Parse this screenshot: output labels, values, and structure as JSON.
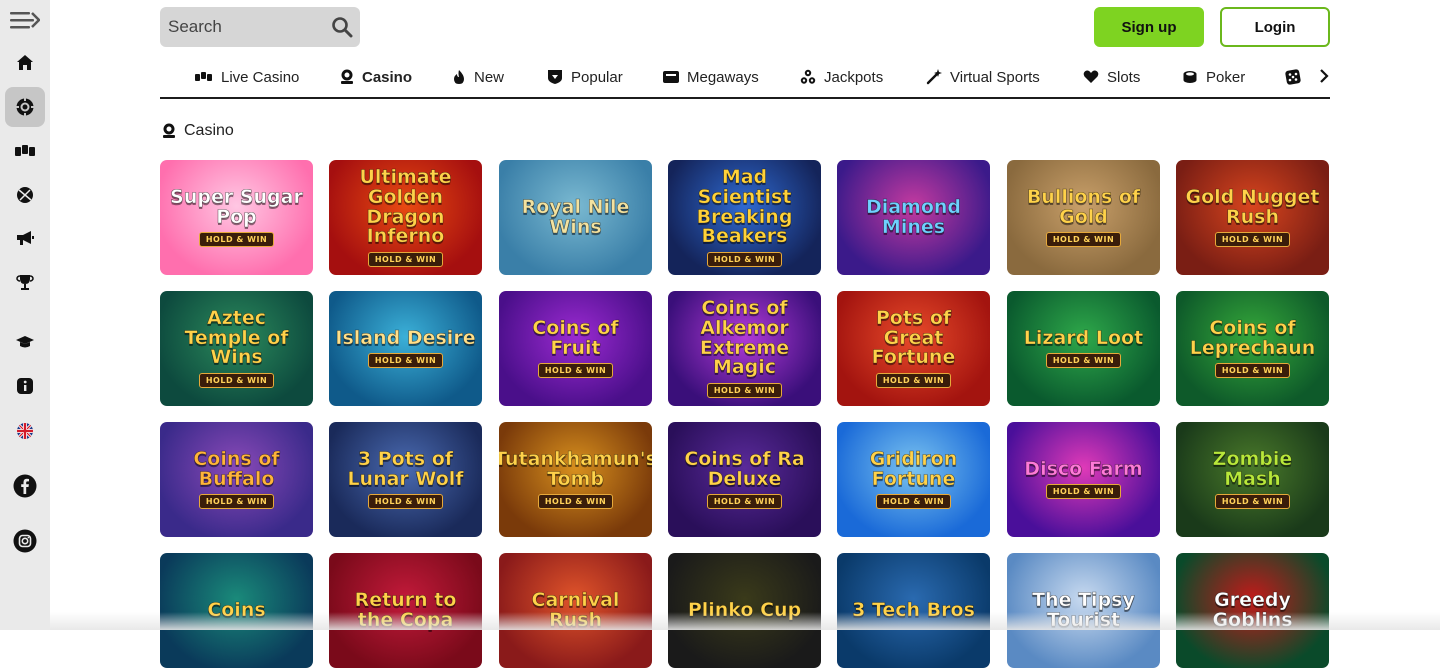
{
  "search": {
    "placeholder": "Search"
  },
  "auth": {
    "signup_label": "Sign up",
    "login_label": "Login"
  },
  "sidebar": {
    "items": [
      {
        "icon": "menu-collapse-icon"
      },
      {
        "icon": "home-icon"
      },
      {
        "icon": "casino-chip-icon",
        "active": true
      },
      {
        "icon": "live-casino-icon"
      },
      {
        "icon": "sports-ball-icon"
      },
      {
        "icon": "promotions-megaphone-icon"
      },
      {
        "icon": "trophy-icon"
      },
      {
        "icon": "academy-icon"
      },
      {
        "icon": "info-icon"
      },
      {
        "icon": "uk-flag-icon"
      },
      {
        "icon": "facebook-icon"
      },
      {
        "icon": "instagram-icon"
      }
    ]
  },
  "categories": [
    {
      "label": "Live Casino",
      "icon": "live-casino-icon"
    },
    {
      "label": "Casino",
      "icon": "casino-icon",
      "active": true
    },
    {
      "label": "New",
      "icon": "flame-icon"
    },
    {
      "label": "Popular",
      "icon": "popular-shield-icon"
    },
    {
      "label": "Megaways",
      "icon": "megaways-icon"
    },
    {
      "label": "Jackpots",
      "icon": "jackpots-icon"
    },
    {
      "label": "Virtual Sports",
      "icon": "virtual-sports-icon"
    },
    {
      "label": "Slots",
      "icon": "slots-heart-icon"
    },
    {
      "label": "Poker",
      "icon": "poker-icon"
    },
    {
      "label": "",
      "icon": "dice-icon"
    }
  ],
  "section": {
    "title": "Casino"
  },
  "games": [
    {
      "title": "Super Sugar Pop",
      "badge": "HOLD & WIN",
      "bg": "#ff6fae",
      "bg2": "#ffc7e3",
      "fg": "#ffffff"
    },
    {
      "title": "Ultimate Golden Dragon Inferno",
      "badge": "HOLD & WIN",
      "bg": "#a50f0f",
      "bg2": "#e84a12",
      "fg": "#ffd24a"
    },
    {
      "title": "Royal Nile Wins",
      "badge": "",
      "bg": "#3a7fa8",
      "bg2": "#7ab9d1",
      "fg": "#f3e2a0"
    },
    {
      "title": "Mad Scientist Breaking Beakers",
      "badge": "HOLD & WIN",
      "bg": "#14245a",
      "bg2": "#2f6ad1",
      "fg": "#ffd23a"
    },
    {
      "title": "Diamond Mines",
      "badge": "",
      "bg": "#3b1a8a",
      "bg2": "#c43aa0",
      "fg": "#6fd0ff"
    },
    {
      "title": "Bullions of Gold",
      "badge": "HOLD & WIN",
      "bg": "#8a6a3e",
      "bg2": "#c9a06a",
      "fg": "#ffd24a"
    },
    {
      "title": "Gold Nugget Rush",
      "badge": "HOLD & WIN",
      "bg": "#7a1e14",
      "bg2": "#d8451e",
      "fg": "#ffd24a"
    },
    {
      "title": "Aztec Temple of Wins",
      "badge": "HOLD & WIN",
      "bg": "#0d4a3e",
      "bg2": "#2b8a5c",
      "fg": "#ffd24a"
    },
    {
      "title": "Island Desire",
      "badge": "HOLD & WIN",
      "bg": "#0f5a8a",
      "bg2": "#3bb0d8",
      "fg": "#ffe08a"
    },
    {
      "title": "Coins of Fruit",
      "badge": "HOLD & WIN",
      "bg": "#4a0f8a",
      "bg2": "#9b2ad1",
      "fg": "#ffd24a"
    },
    {
      "title": "Coins of Alkemor Extreme Magic",
      "badge": "HOLD & WIN",
      "bg": "#3a0f7a",
      "bg2": "#b23ad8",
      "fg": "#ffd24a"
    },
    {
      "title": "Pots of Great Fortune",
      "badge": "HOLD & WIN",
      "bg": "#a3140f",
      "bg2": "#e84a2a",
      "fg": "#ffd24a"
    },
    {
      "title": "Lizard Loot",
      "badge": "HOLD & WIN",
      "bg": "#0a5a2e",
      "bg2": "#2ea84a",
      "fg": "#ffd24a"
    },
    {
      "title": "Coins of Leprechaun",
      "badge": "HOLD & WIN",
      "bg": "#0e5a2a",
      "bg2": "#35a83a",
      "fg": "#ffd24a"
    },
    {
      "title": "Coins of Buffalo",
      "badge": "HOLD & WIN",
      "bg": "#3a2a8a",
      "bg2": "#8a4ab8",
      "fg": "#ffb43a"
    },
    {
      "title": "3 Pots of Lunar Wolf",
      "badge": "HOLD & WIN",
      "bg": "#1a2a5a",
      "bg2": "#4a6ab0",
      "fg": "#ffd24a"
    },
    {
      "title": "Tutankhamun's Tomb",
      "badge": "HOLD & WIN",
      "bg": "#7a3a0a",
      "bg2": "#d8901e",
      "fg": "#ffd24a"
    },
    {
      "title": "Coins of Ra Deluxe",
      "badge": "HOLD & WIN",
      "bg": "#2a0f5a",
      "bg2": "#5a2a9a",
      "fg": "#ffd24a"
    },
    {
      "title": "Gridiron Fortune",
      "badge": "HOLD & WIN",
      "bg": "#1a6ad8",
      "bg2": "#7ac3f0",
      "fg": "#ffd24a"
    },
    {
      "title": "Disco Farm",
      "badge": "HOLD & WIN",
      "bg": "#4a0f9a",
      "bg2": "#e03ab8",
      "fg": "#ff7ad8"
    },
    {
      "title": "Zombie Mash",
      "badge": "HOLD & WIN",
      "bg": "#1a3a1a",
      "bg2": "#4a7a2a",
      "fg": "#b8e83a"
    },
    {
      "title": "Coins",
      "badge": "",
      "bg": "#0a3a5a",
      "bg2": "#1a8a7a",
      "fg": "#ffd24a"
    },
    {
      "title": "Return to the Copa",
      "badge": "",
      "bg": "#7a0a1a",
      "bg2": "#c21a3a",
      "fg": "#ffd24a"
    },
    {
      "title": "Carnival Rush",
      "badge": "",
      "bg": "#8a1a1a",
      "bg2": "#e0542a",
      "fg": "#ffd24a"
    },
    {
      "title": "Plinko Cup",
      "badge": "",
      "bg": "#1a1a1a",
      "bg2": "#3a3a1a",
      "fg": "#ffd24a"
    },
    {
      "title": "3 Tech Bros",
      "badge": "",
      "bg": "#0a3a6a",
      "bg2": "#2a6ab0",
      "fg": "#ffd24a"
    },
    {
      "title": "The Tipsy Tourist",
      "badge": "",
      "bg": "#5a8ac3",
      "bg2": "#c8daf0",
      "fg": "#ffffff"
    },
    {
      "title": "Greedy Goblins",
      "badge": "",
      "bg": "#0a4a2a",
      "bg2": "#c21a1a",
      "fg": "#ffffff"
    }
  ]
}
